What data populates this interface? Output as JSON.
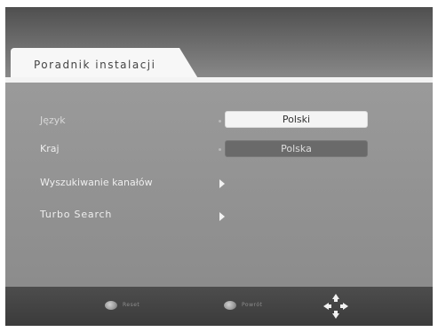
{
  "header": {
    "tab_title": "Poradnik instalacji"
  },
  "settings": {
    "rows": [
      {
        "label": "Język",
        "value": "Polski"
      },
      {
        "label": "Kraj",
        "value": "Polska"
      },
      {
        "label": "Wyszukiwanie kanałów"
      },
      {
        "label": "Turbo Search"
      }
    ]
  },
  "footer": {
    "buttons": [
      {
        "icon": "red-button-icon",
        "label": "Reset"
      },
      {
        "icon": "green-button-icon",
        "label": "Powrót"
      }
    ],
    "nav_icon": "dpad-navigation-icon"
  }
}
